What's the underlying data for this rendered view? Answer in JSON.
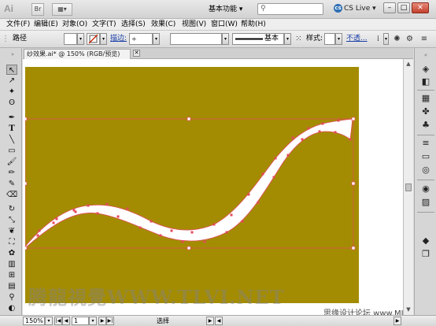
{
  "app": {
    "logo": "Ai",
    "workspace": "基本功能",
    "search_placeholder": "",
    "cs_live": "CS Live"
  },
  "window_controls": [
    "minimize",
    "maximize",
    "close"
  ],
  "menu": [
    "文件(F)",
    "编辑(E)",
    "对象(O)",
    "文字(T)",
    "选择(S)",
    "效果(C)",
    "视图(V)",
    "窗口(W)",
    "帮助(H)"
  ],
  "control_bar": {
    "path_label": "路径",
    "stroke_label": "描边:",
    "brush_value": "基本",
    "style_label": "样式:",
    "opacity_label": "不透...",
    "colors": {
      "fill": "#ffffff",
      "stroke_none": "#cc2200"
    }
  },
  "document": {
    "tab_title": "纱效果.ai* @ 150% (RGB/预览)",
    "artboard_color": "#a48c02",
    "shape_fill": "#ffffff",
    "selection_color": "#e24a5a"
  },
  "watermark": "腾龍視覺WWW.TLVI.NET",
  "credit": "思缘设计论坛 www.MISSYUAN.COM",
  "status": {
    "zoom": "150%",
    "artboard": "1",
    "tool": "选择"
  },
  "tools": [
    "selection-tool",
    "direct-selection-tool",
    "magic-wand-tool",
    "lasso-tool",
    "pen-tool",
    "type-tool",
    "line-tool",
    "rectangle-tool",
    "paintbrush-tool",
    "pencil-tool",
    "blob-brush-tool",
    "eraser-tool",
    "rotate-tool",
    "scale-tool",
    "warp-tool",
    "free-transform-tool",
    "symbol-sprayer-tool",
    "graph-tool",
    "mesh-tool",
    "gradient-tool",
    "eyedropper-tool",
    "blend-tool",
    "slice-tool",
    "hand-tool",
    "zoom-tool"
  ],
  "panels": [
    "color-panel-icon",
    "color-guide-icon",
    "swatches-icon",
    "brushes-icon",
    "symbols-icon",
    "stroke-icon",
    "gradient-icon",
    "transparency-icon",
    "appearance-icon",
    "graphic-styles-icon",
    "layers-icon",
    "artboards-icon"
  ]
}
